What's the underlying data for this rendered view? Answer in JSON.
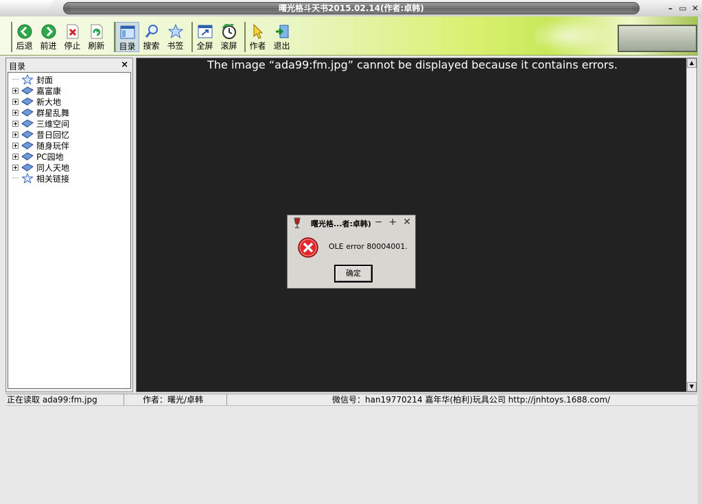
{
  "window": {
    "title": "曙光格斗天书2015.02.14(作者:卓韩)",
    "controls": {
      "minimize": "–",
      "restore": "▭",
      "close": "✕"
    }
  },
  "toolbar": {
    "groups": [
      [
        {
          "label": "后退",
          "icon": "back-arrow-icon"
        },
        {
          "label": "前进",
          "icon": "forward-arrow-icon"
        },
        {
          "label": "停止",
          "icon": "stop-icon"
        },
        {
          "label": "刷新",
          "icon": "refresh-icon"
        }
      ],
      [
        {
          "label": "目录",
          "icon": "contents-icon"
        },
        {
          "label": "搜索",
          "icon": "search-icon"
        },
        {
          "label": "书签",
          "icon": "bookmark-star-icon"
        }
      ],
      [
        {
          "label": "全屏",
          "icon": "fullscreen-icon"
        },
        {
          "label": "滚屏",
          "icon": "scroll-clock-icon"
        }
      ],
      [
        {
          "label": "作者",
          "icon": "author-cursor-icon"
        },
        {
          "label": "退出",
          "icon": "exit-door-icon"
        }
      ]
    ]
  },
  "sidebar": {
    "title": "目录",
    "close_glyph": "×",
    "items": [
      {
        "label": "封面",
        "type": "leaf"
      },
      {
        "label": "嘉富康",
        "type": "book"
      },
      {
        "label": "新大地",
        "type": "book"
      },
      {
        "label": "群星乱舞",
        "type": "book"
      },
      {
        "label": "三维空间",
        "type": "book"
      },
      {
        "label": "昔日回忆",
        "type": "book"
      },
      {
        "label": "随身玩伴",
        "type": "book"
      },
      {
        "label": "PC园地",
        "type": "book"
      },
      {
        "label": "同人天地",
        "type": "book"
      },
      {
        "label": "相关链接",
        "type": "leaf"
      }
    ]
  },
  "main": {
    "error_message": "The image “ada99:fm.jpg” cannot be displayed because it contains errors."
  },
  "dialog": {
    "title": "曙光格...者:卓韩)",
    "message": "OLE error 80004001.",
    "ok_label": "确定",
    "controls": {
      "minimize": "−",
      "maximize": "+",
      "close": "✕"
    }
  },
  "statusbar": {
    "reading": "正在读取 ada99:fm.jpg",
    "author": "作者：曙光/卓韩",
    "info": "微信号：han19770214   嘉年华(柏利)玩具公司 http://jnhtoys.1688.com/"
  }
}
